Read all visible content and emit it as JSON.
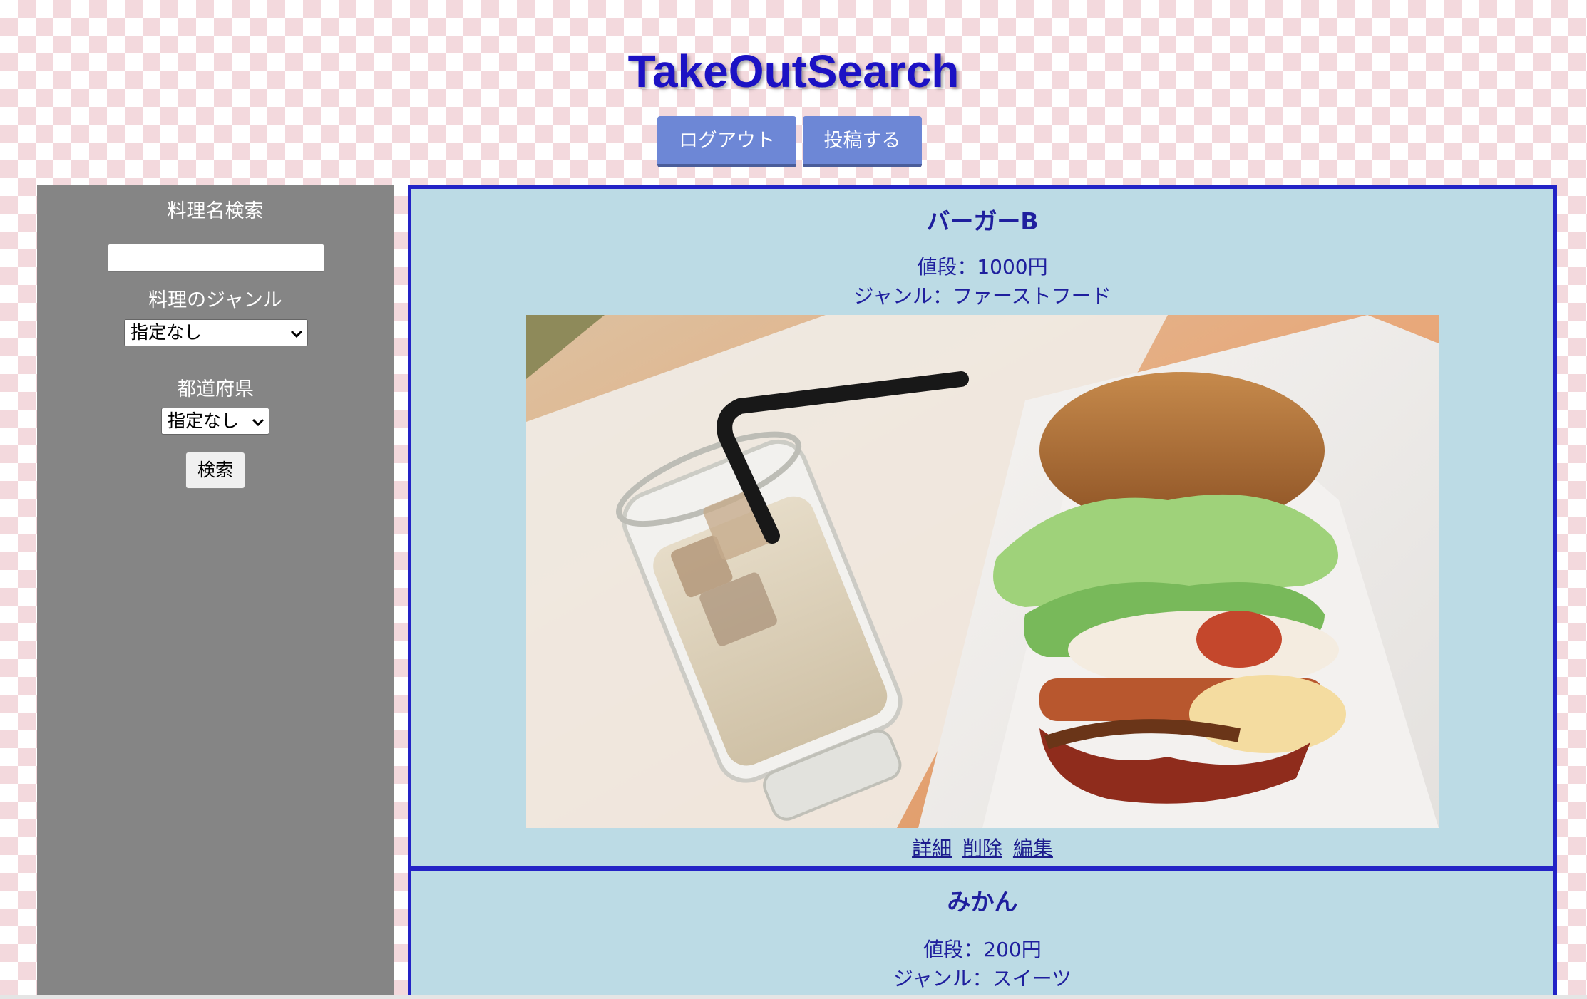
{
  "header": {
    "title": "TakeOutSearch",
    "logout_label": "ログアウト",
    "post_label": "投稿する"
  },
  "sidebar": {
    "name_search_label": "料理名検索",
    "name_search_value": "",
    "genre_label": "料理のジャンル",
    "genre_selected": "指定なし",
    "prefecture_label": "都道府県",
    "prefecture_selected": "指定なし",
    "search_button_label": "検索"
  },
  "posts": [
    {
      "name": "バーガーB",
      "price": "値段：1000円",
      "genre": "ジャンル：ファーストフード",
      "photo": "burger-and-iced-latte-photo",
      "links": {
        "detail": "詳細",
        "delete": "削除",
        "edit": "編集"
      }
    },
    {
      "name": "みかん",
      "price": "値段：200円",
      "genre": "ジャンル：スイーツ"
    }
  ],
  "colors": {
    "title": "#1c12c4",
    "header_button": "#6d87d6",
    "sidebar_bg": "#858585",
    "card_bg": "#bcdbe5",
    "card_border": "#2323c6",
    "card_text": "#1f1f9e"
  },
  "icons": {
    "select_arrow": "chevron-down-icon"
  }
}
